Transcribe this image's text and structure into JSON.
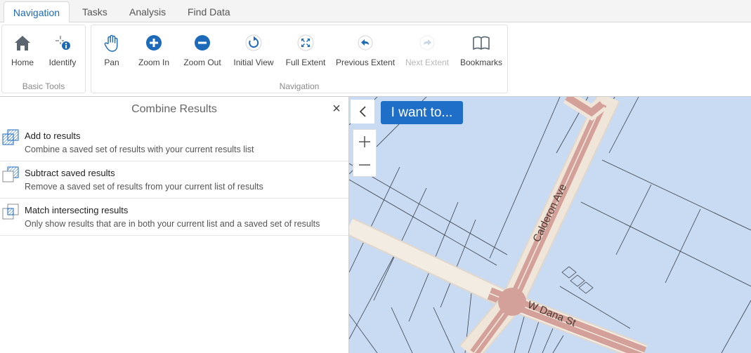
{
  "tabs": {
    "navigation": "Navigation",
    "tasks": "Tasks",
    "analysis": "Analysis",
    "find_data": "Find Data"
  },
  "ribbon": {
    "basic_tools": {
      "label": "Basic Tools",
      "home": "Home",
      "identify": "Identify"
    },
    "navigation": {
      "label": "Navigation",
      "pan": "Pan",
      "zoom_in": "Zoom In",
      "zoom_out": "Zoom Out",
      "initial_view": "Initial View",
      "full_extent": "Full Extent",
      "previous_extent": "Previous Extent",
      "next_extent": "Next Extent",
      "bookmarks": "Bookmarks"
    }
  },
  "panel": {
    "title": "Combine Results",
    "close_symbol": "×",
    "items": [
      {
        "title": "Add to results",
        "description": "Combine a saved set of results with your current results list"
      },
      {
        "title": "Subtract saved results",
        "description": "Remove a saved set of results from your current list of results"
      },
      {
        "title": "Match intersecting results",
        "description": "Only show results that are in both your current list and a saved set of results"
      }
    ]
  },
  "map": {
    "i_want_to": "I want to...",
    "streets": {
      "calderon": "Calderon Ave",
      "dana": "W Dana St"
    }
  },
  "colors": {
    "accent": "#1d6aba",
    "button": "#1f6ec8",
    "map_water": "#c9dbf3",
    "road_casing": "#efe3d6",
    "road_fill": "#dbaaa4"
  }
}
